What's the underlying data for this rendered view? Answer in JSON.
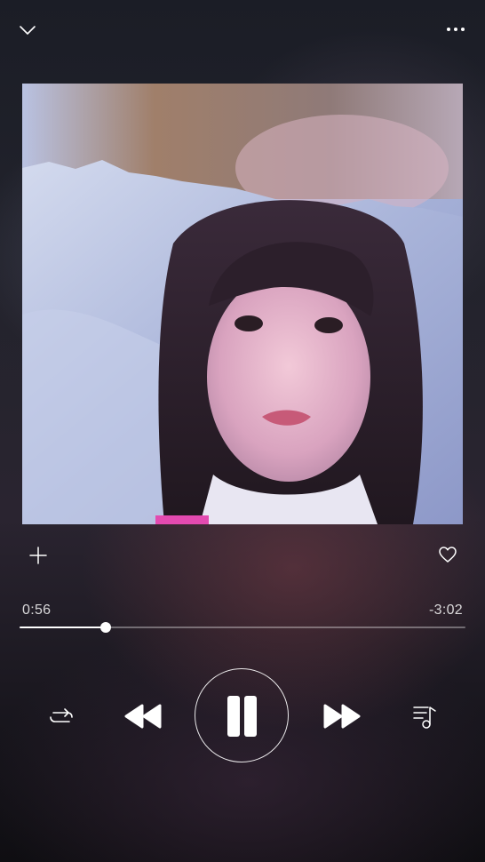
{
  "player": {
    "elapsed": "0:56",
    "remaining": "-3:02",
    "progress_fraction": 0.194,
    "state": "playing"
  },
  "icons": {
    "collapse": "chevron-down-icon",
    "more": "more-dots-icon",
    "add": "plus-icon",
    "favorite": "heart-icon",
    "repeat": "repeat-icon",
    "previous": "rewind-icon",
    "pause": "pause-icon",
    "next": "fast-forward-icon",
    "queue": "queue-list-icon"
  },
  "colors": {
    "foreground": "#ffffff",
    "track": "#ffffff59",
    "background_top": "#1b1d26",
    "background_bottom": "#0f0e12"
  }
}
